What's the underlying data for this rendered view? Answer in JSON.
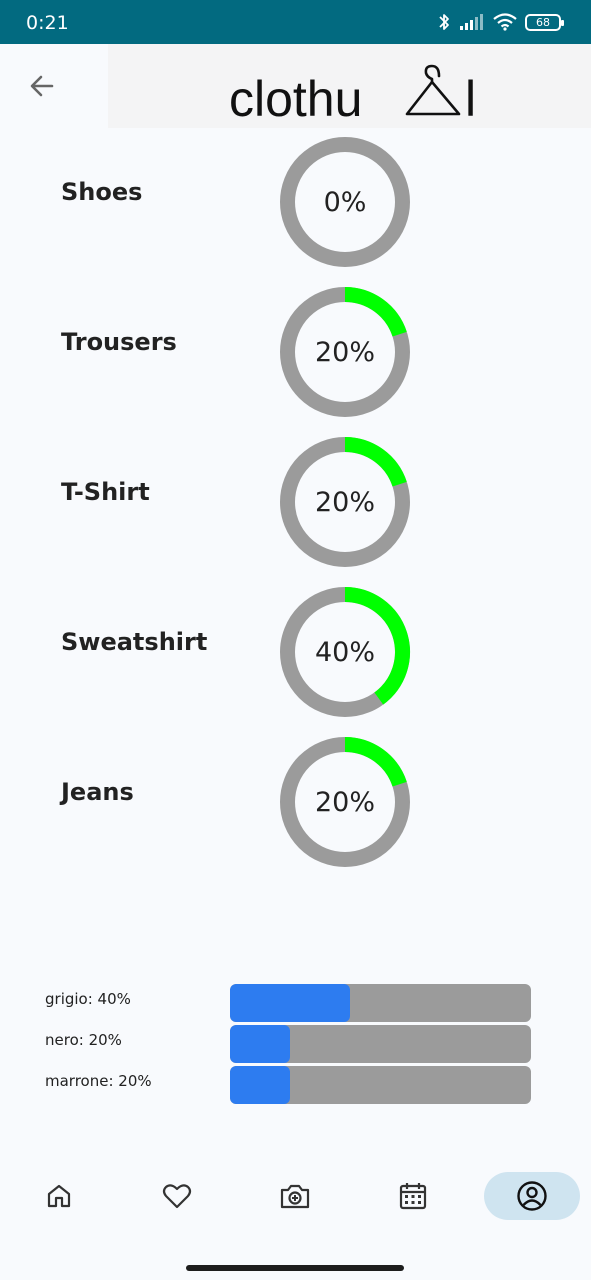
{
  "status_bar": {
    "time": "0:21",
    "battery": "68",
    "icons": [
      "bluetooth-icon",
      "signal-icon",
      "wifi-icon",
      "battery-icon"
    ]
  },
  "header": {
    "back_icon": "arrow-left-icon",
    "logo_text": "clothu",
    "logo_suffix": "l"
  },
  "categories": [
    {
      "label": "Shoes",
      "value": 0,
      "percent_text": "0%"
    },
    {
      "label": "Trousers",
      "value": 0.2,
      "percent_text": "20%"
    },
    {
      "label": "T-Shirt",
      "value": 0.2,
      "percent_text": "20%"
    },
    {
      "label": "Sweatshirt",
      "value": 0.4,
      "percent_text": "40%"
    },
    {
      "label": "Jeans",
      "value": 0.2,
      "percent_text": "20%"
    }
  ],
  "colors": [
    {
      "label": "grigio: 40%",
      "value": 0.4
    },
    {
      "label": "nero: 20%",
      "value": 0.2
    },
    {
      "label": "marrone: 20%",
      "value": 0.2
    }
  ],
  "bottom_nav": [
    {
      "name": "home",
      "icon": "home-icon",
      "active": false
    },
    {
      "name": "favorites",
      "icon": "heart-icon",
      "active": false
    },
    {
      "name": "add-photo",
      "icon": "camera-plus-icon",
      "active": false
    },
    {
      "name": "calendar",
      "icon": "calendar-icon",
      "active": false
    },
    {
      "name": "profile",
      "icon": "account-circle-icon",
      "active": true
    }
  ],
  "theme": {
    "status_bar": "#026a80",
    "ring_track": "#9b9b9b",
    "ring_fill": "#00ff00",
    "bar_fill": "#2d7cf0",
    "nav_active": "#cfe4f0"
  }
}
